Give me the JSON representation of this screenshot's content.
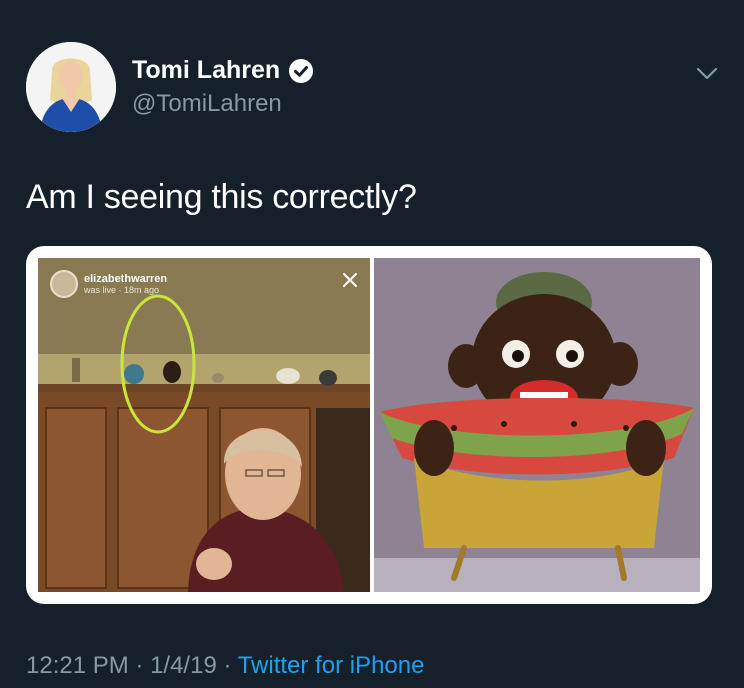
{
  "tweet": {
    "author": {
      "display_name": "Tomi Lahren",
      "handle": "@TomiLahren",
      "verified": true
    },
    "text": "Am I seeing this correctly?",
    "media": {
      "left_panel": {
        "story_username": "elizabethwarren",
        "story_status": "was live · 18m ago"
      }
    },
    "meta": {
      "time": "12:21 PM",
      "separator1": " · ",
      "date": "1/4/19",
      "separator2": " · ",
      "source": "Twitter for iPhone"
    }
  },
  "colors": {
    "background": "#15202b",
    "secondary_text": "#8899a6",
    "link": "#1da1f2",
    "highlight_circle": "#c8e63c"
  },
  "icons": {
    "verified": "verified-badge-icon",
    "menu": "chevron-down-icon",
    "story_close": "close-icon"
  }
}
